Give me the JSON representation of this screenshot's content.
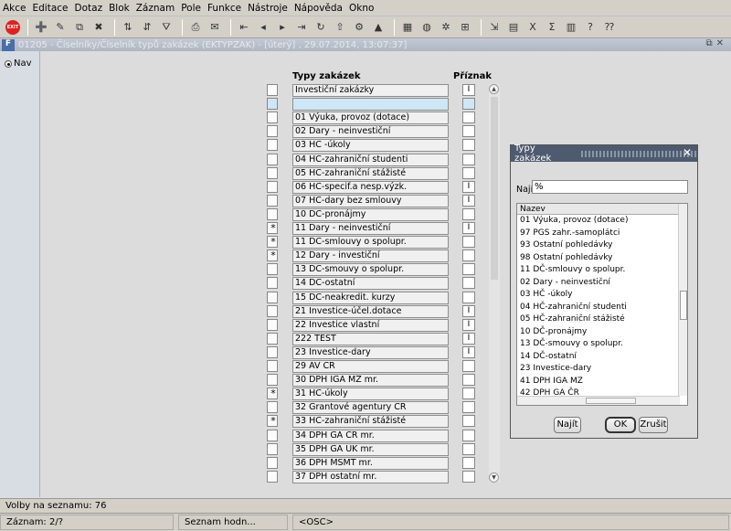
{
  "menu": [
    "Akce",
    "Editace",
    "Dotaz",
    "Blok",
    "Záznam",
    "Pole",
    "Funkce",
    "Nástroje",
    "Nápověda",
    "Okno"
  ],
  "toolbar": {
    "exit_label": "EXIT"
  },
  "window": {
    "app_icon": "F",
    "title": "01205 - Číselníky/Číselník typů zakázek (EKTYPZAK) - [úterý]   , 29.07.2014, 13:07:37]"
  },
  "nav": {
    "label": "Nav"
  },
  "grid": {
    "col_name_header": "Typy zakázek",
    "col_flag_header": "Příznak",
    "rows": [
      {
        "mark": "",
        "name": "Investiční zakázky",
        "flag": "I",
        "current": false
      },
      {
        "mark": "",
        "name": "",
        "flag": "",
        "current": true
      },
      {
        "mark": "",
        "name": "01 Výuka, provoz (dotace)",
        "flag": "",
        "current": false
      },
      {
        "mark": "",
        "name": "02 Dary - neinvestiční",
        "flag": "",
        "current": false
      },
      {
        "mark": "",
        "name": "03 HČ -úkoly",
        "flag": "",
        "current": false
      },
      {
        "mark": "",
        "name": "04 HČ-zahraniční studenti",
        "flag": "",
        "current": false
      },
      {
        "mark": "",
        "name": "05 HČ-zahraniční stážisté",
        "flag": "",
        "current": false
      },
      {
        "mark": "",
        "name": "06 HČ-specif.a nesp.výzk.",
        "flag": "I",
        "current": false
      },
      {
        "mark": "",
        "name": "07 HČ-dary bez smlouvy",
        "flag": "I",
        "current": false
      },
      {
        "mark": "",
        "name": "10 DČ-pronájmy",
        "flag": "",
        "current": false
      },
      {
        "mark": "*",
        "name": "11 Dary - neinvestiční",
        "flag": "I",
        "current": false
      },
      {
        "mark": "*",
        "name": "11 DČ-smlouvy o spolupr.",
        "flag": "",
        "current": false
      },
      {
        "mark": "*",
        "name": "12 Dary - investiční",
        "flag": "",
        "current": false
      },
      {
        "mark": "",
        "name": "13 DČ-smouvy o spolupr.",
        "flag": "",
        "current": false
      },
      {
        "mark": "",
        "name": "14 DČ-ostatní",
        "flag": "",
        "current": false
      },
      {
        "mark": "",
        "name": "15 DČ-neakredit. kurzy",
        "flag": "",
        "current": false
      },
      {
        "mark": "",
        "name": "21 Investice-účel.dotace",
        "flag": "I",
        "current": false
      },
      {
        "mark": "",
        "name": "22 Investice vlastní",
        "flag": "I",
        "current": false
      },
      {
        "mark": "",
        "name": "222 TEST",
        "flag": "I",
        "current": false
      },
      {
        "mark": "",
        "name": "23 Investice-dary",
        "flag": "I",
        "current": false
      },
      {
        "mark": "",
        "name": "29 AV ČR",
        "flag": "",
        "current": false
      },
      {
        "mark": "",
        "name": "30 DPH IGA MZ mr.",
        "flag": "",
        "current": false
      },
      {
        "mark": "*",
        "name": "31 HČ-úkoly",
        "flag": "",
        "current": false
      },
      {
        "mark": "",
        "name": "32 Grantové agentury ČR",
        "flag": "",
        "current": false
      },
      {
        "mark": "*",
        "name": "33 HČ-zahraniční stážisté",
        "flag": "",
        "current": false
      },
      {
        "mark": "",
        "name": "34 DPH GA ČR mr.",
        "flag": "",
        "current": false
      },
      {
        "mark": "",
        "name": "35 DPH GA UK mr.",
        "flag": "",
        "current": false
      },
      {
        "mark": "",
        "name": "36 DPH MŠMT mr.",
        "flag": "",
        "current": false
      },
      {
        "mark": "",
        "name": "37 DPH ostatní mr.",
        "flag": "",
        "current": false
      }
    ]
  },
  "dialog": {
    "title": "Typy zakázek",
    "close": "✕",
    "find_label": "Najít",
    "find_value": "%",
    "list_header": "Nazev",
    "items": [
      "01 Výuka, provoz (dotace)",
      "97 PGS zahr.-samoplátci",
      "93 Ostatní pohledávky",
      "98 Ostatní pohledávky",
      "11 DČ-smlouvy o spolupr.",
      "02 Dary - neinvestiční",
      "03 HČ -úkoly",
      "04 HČ-zahraniční studenti",
      "05 HČ-zahraniční stážisté",
      "10 DČ-pronájmy",
      "13 DČ-smouvy o spolupr.",
      "14 DČ-ostatní",
      "23 Investice-dary",
      "41 DPH IGA MZ",
      "42 DPH GA ČR"
    ],
    "find_button": "Najít",
    "ok_button": "OK",
    "cancel_button": "Zrušit"
  },
  "status": {
    "line1": "Volby na seznamu: 76",
    "record": "Záznam: 2/?",
    "list_value": "Seznam hodn...",
    "osc": "<OSC>"
  }
}
